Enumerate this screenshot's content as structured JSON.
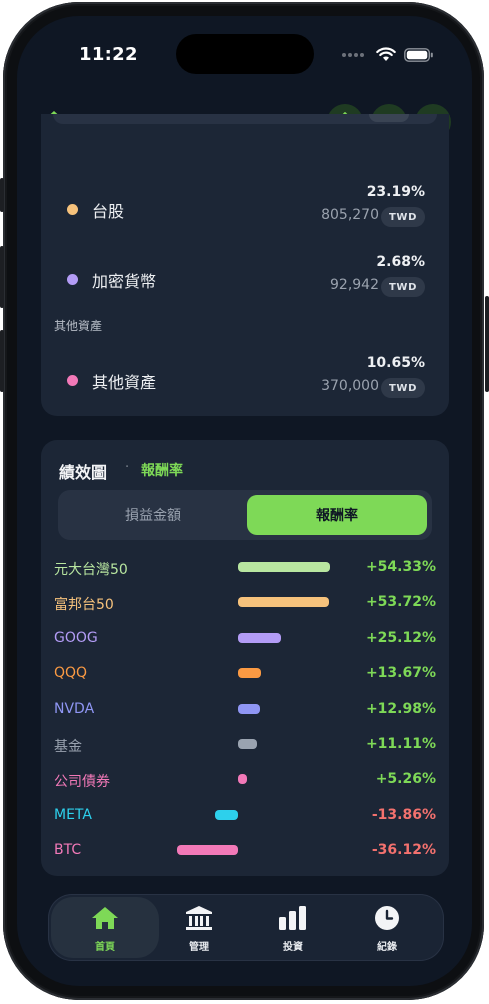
{
  "status": {
    "time": "11:22"
  },
  "header": {
    "title": "首頁"
  },
  "allocation": {
    "assets": [
      {
        "name": "台股",
        "percent": "23.19%",
        "amount": "805,270",
        "currency": "TWD",
        "color": "#f6c27c"
      },
      {
        "name": "加密貨幣",
        "percent": "2.68%",
        "amount": "92,942",
        "currency": "TWD",
        "color": "#b39cf6"
      }
    ],
    "other_section_label": "其他資產",
    "other": [
      {
        "name": "其他資產",
        "percent": "10.65%",
        "amount": "370,000",
        "currency": "TWD",
        "color": "#f279b8"
      }
    ]
  },
  "performance": {
    "title": "績效圖",
    "separator": "·",
    "mode_label": "報酬率",
    "segments": [
      "損益金額",
      "報酬率"
    ],
    "selected_segment": 1,
    "items": [
      {
        "name": "元大台灣50",
        "value": 54.33,
        "display": "+54.33%",
        "color": "#b8e6a0"
      },
      {
        "name": "富邦台50",
        "value": 53.72,
        "display": "+53.72%",
        "color": "#f6c27c"
      },
      {
        "name": "GOOG",
        "value": 25.12,
        "display": "+25.12%",
        "color": "#b39cf6"
      },
      {
        "name": "QQQ",
        "value": 13.67,
        "display": "+13.67%",
        "color": "#fb9a43"
      },
      {
        "name": "NVDA",
        "value": 12.98,
        "display": "+12.98%",
        "color": "#8f96f4"
      },
      {
        "name": "基金",
        "value": 11.11,
        "display": "+11.11%",
        "color": "#9aa3b0"
      },
      {
        "name": "公司債券",
        "value": 5.26,
        "display": "+5.26%",
        "color": "#f279b8"
      },
      {
        "name": "META",
        "value": -13.86,
        "display": "-13.86%",
        "color": "#2dd0ec"
      },
      {
        "name": "BTC",
        "value": -36.12,
        "display": "-36.12%",
        "color": "#f279b8"
      }
    ],
    "positive_color": "#7ed957",
    "negative_color": "#f3716e"
  },
  "tabs": [
    {
      "label": "首頁",
      "icon": "home-icon",
      "active": true
    },
    {
      "label": "管理",
      "icon": "bank-icon",
      "active": false
    },
    {
      "label": "投資",
      "icon": "bar-chart-icon",
      "active": false
    },
    {
      "label": "紀錄",
      "icon": "clock-icon",
      "active": false
    }
  ]
}
